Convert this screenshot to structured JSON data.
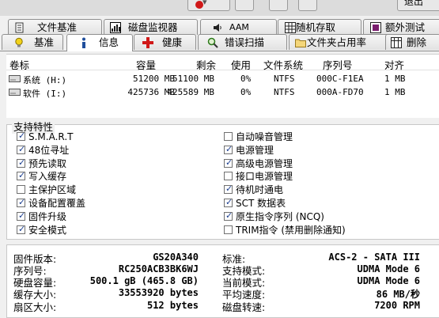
{
  "top": {
    "exit_label": "退出"
  },
  "tabs_row1": [
    {
      "label": "文件基准",
      "icon": "file-icon"
    },
    {
      "label": "磁盘监视器",
      "icon": "monitor-graph-icon"
    },
    {
      "label": "AAM",
      "icon": "speaker-icon"
    },
    {
      "label": "随机存取",
      "icon": "grid-icon"
    },
    {
      "label": "额外测试",
      "icon": "extra-test-icon"
    }
  ],
  "tabs_row2": [
    {
      "label": "基准",
      "icon": "lightbulb-icon"
    },
    {
      "label": "信息",
      "icon": "info-icon",
      "active": true
    },
    {
      "label": "健康",
      "icon": "health-cross-icon"
    },
    {
      "label": "错误扫描",
      "icon": "magnifier-icon"
    },
    {
      "label": "文件夹占用率",
      "icon": "folder-icon"
    },
    {
      "label": "删除",
      "icon": "delete-icon"
    }
  ],
  "volumes": {
    "headers": {
      "label": "卷标",
      "capacity": "容量",
      "free": "剩余",
      "used": "使用",
      "fs": "文件系统",
      "serial": "序列号",
      "align": "对齐"
    },
    "rows": [
      {
        "label": "系统 (H:)",
        "capacity": "51200 MB",
        "free": "51100 MB",
        "used": "0%",
        "fs": "NTFS",
        "serial": "000C-F1EA",
        "align": "1 MB"
      },
      {
        "label": "软件 (I:)",
        "capacity": "425736 MB",
        "free": "425589 MB",
        "used": "0%",
        "fs": "NTFS",
        "serial": "000A-FD70",
        "align": "1 MB"
      }
    ]
  },
  "features": {
    "title": "支持特性",
    "left": [
      {
        "label": "S.M.A.R.T",
        "checked": true
      },
      {
        "label": "48位寻址",
        "checked": true
      },
      {
        "label": "预先读取",
        "checked": true
      },
      {
        "label": "写入缓存",
        "checked": true
      },
      {
        "label": "主保护区域",
        "checked": false
      },
      {
        "label": "设备配置覆盖",
        "checked": true
      },
      {
        "label": "固件升级",
        "checked": true
      },
      {
        "label": "安全模式",
        "checked": true
      }
    ],
    "right": [
      {
        "label": "自动噪音管理",
        "checked": false
      },
      {
        "label": "电源管理",
        "checked": true
      },
      {
        "label": "高级电源管理",
        "checked": true
      },
      {
        "label": "接口电源管理",
        "checked": false
      },
      {
        "label": "待机时通电",
        "checked": true
      },
      {
        "label": "SCT 数据表",
        "checked": true
      },
      {
        "label": "原生指令序列 (NCQ)",
        "checked": true
      },
      {
        "label": "TRIM指令 (禁用删除通知)",
        "checked": false
      }
    ]
  },
  "details": {
    "left": [
      {
        "label": "固件版本:",
        "value": "GS20A340"
      },
      {
        "label": "序列号:",
        "value": "RC250ACB3BK6WJ"
      },
      {
        "label": "硬盘容量:",
        "value": "500.1 gB (465.8 GB)"
      },
      {
        "label": "缓存大小:",
        "value": "33553920 bytes"
      },
      {
        "label": "扇区大小:",
        "value": "512 bytes"
      }
    ],
    "right": [
      {
        "label": "标准:",
        "value": "ACS-2 - SATA III"
      },
      {
        "label": "支持模式:",
        "value": "UDMA Mode 6"
      },
      {
        "label": "当前模式:",
        "value": "UDMA Mode 6"
      },
      {
        "label": "平均速度:",
        "value": "86 MB/秒"
      },
      {
        "label": "磁盘转速:",
        "value": "7200 RPM"
      }
    ]
  },
  "colors": {
    "check": "#1a3d8f",
    "health_red": "#d01818"
  }
}
